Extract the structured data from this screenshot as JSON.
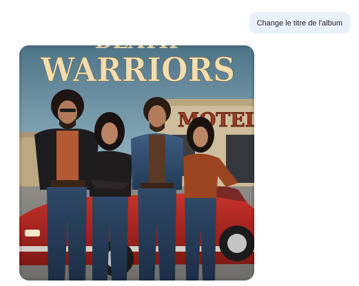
{
  "conversation": {
    "user_message": "Change le titre de l'album",
    "generated_image": {
      "title_top_partial": "DEATH",
      "title_main": "WARRIORS",
      "sign_text": "MOTEL"
    }
  },
  "colors": {
    "user_bubble_bg": "#e8f0fa",
    "title_color": "#f1ddb0",
    "sign_color": "#9b3a22",
    "car_color": "#b22420",
    "sky_top": "#4e7488",
    "sky_bottom": "#8fb1bf"
  }
}
